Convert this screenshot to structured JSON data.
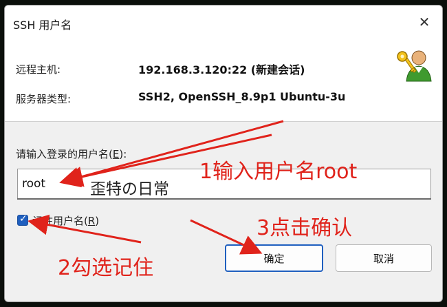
{
  "dialog": {
    "title": "SSH 用户名",
    "host_label": "远程主机:",
    "host_value": "192.168.3.120:22 (新建会话)",
    "server_type_label": "服务器类型:",
    "server_type_value": "SSH2, OpenSSH_8.9p1 Ubuntu-3u",
    "username_prompt": "请输入登录的用户名(",
    "username_prompt_key": "E",
    "username_prompt_end": "):",
    "username_value": "root",
    "remember_label": "记住用户名(",
    "remember_key": "R",
    "remember_end": ")",
    "remember_checked": true,
    "ok_label": "确定",
    "cancel_label": "取消",
    "close_glyph": "✕",
    "check_glyph": "✓",
    "watermark": "歪特の日常"
  },
  "annotations": {
    "step1": "1输入用户名root",
    "step2": "2勾选记住",
    "step3": "3点击确认",
    "color": "#e0231b"
  },
  "icons": {
    "user": "user-with-key-icon",
    "close": "close-icon",
    "checkbox": "checkbox-checked-icon"
  }
}
